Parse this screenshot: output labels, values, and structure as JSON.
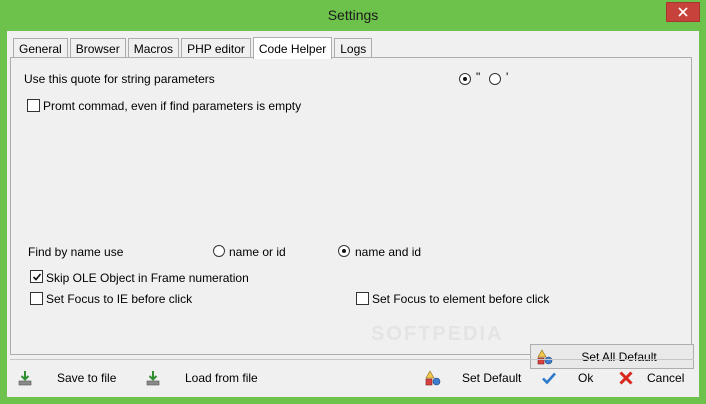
{
  "window": {
    "title": "Settings"
  },
  "tabs": [
    {
      "label": "General",
      "active": false
    },
    {
      "label": "Browser",
      "active": false
    },
    {
      "label": "Macros",
      "active": false
    },
    {
      "label": "PHP editor",
      "active": false
    },
    {
      "label": "Code Helper",
      "active": true
    },
    {
      "label": "Logs",
      "active": false
    }
  ],
  "code_helper": {
    "quote_label": "Use this quote for string parameters",
    "quote_options": [
      {
        "label": "\"",
        "selected": true
      },
      {
        "label": "'",
        "selected": false
      }
    ],
    "prompt_checkbox": {
      "label": "Promt commad, even if find parameters is empty",
      "checked": false
    },
    "find_by_label": "Find by name use",
    "find_by_options": [
      {
        "label": "name or id",
        "selected": false
      },
      {
        "label": "name and id",
        "selected": true
      }
    ],
    "skip_ole": {
      "label": "Skip OLE Object in Frame numeration",
      "checked": true
    },
    "focus_ie": {
      "label": "Set Focus to IE before click",
      "checked": false
    },
    "focus_element": {
      "label": "Set Focus to element before click",
      "checked": false
    },
    "set_all_default": "Set All Default"
  },
  "watermark": "SOFTPEDIA",
  "footer": {
    "save_to_file": "Save to file",
    "load_from_file": "Load from file",
    "set_default": "Set Default",
    "ok": "Ok",
    "cancel": "Cancel"
  },
  "colors": {
    "frame": "#6dc24b",
    "close": "#c7423a",
    "ok_check": "#2b79c9",
    "cancel_x": "#d9261c"
  }
}
